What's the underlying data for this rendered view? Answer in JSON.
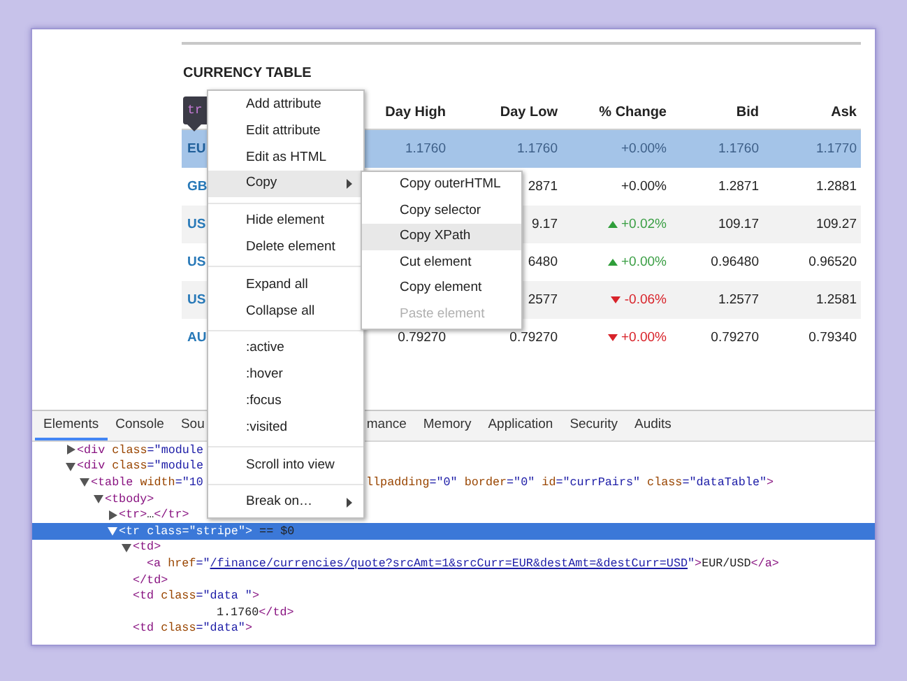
{
  "page": {
    "heading": "CURRENCY TABLE",
    "tooltip": "tr"
  },
  "table": {
    "columns": [
      "",
      "Day High",
      "Day Low",
      "% Change",
      "Bid",
      "Ask"
    ],
    "rows": [
      {
        "pair": "EU",
        "day_high": "1.1760",
        "day_low": "1.1760",
        "change": "+0.00%",
        "trend_up": false,
        "trend_down": false,
        "bid": "1.1760",
        "ask": "1.1770",
        "selected": true
      },
      {
        "pair": "GB",
        "day_low": "2871",
        "change": "+0.00%",
        "trend_up": false,
        "trend_down": false,
        "bid": "1.2871",
        "ask": "1.2881",
        "selected": false
      },
      {
        "pair": "US",
        "day_low": "9.17",
        "change": "+0.02%",
        "trend_up": true,
        "trend_down": false,
        "bid": "109.17",
        "ask": "109.27",
        "selected": false
      },
      {
        "pair": "US",
        "day_low": "6480",
        "change": "+0.00%",
        "trend_up": true,
        "trend_down": false,
        "bid": "0.96480",
        "ask": "0.96520",
        "selected": false
      },
      {
        "pair": "US",
        "day_low": "2577",
        "change": "-0.06%",
        "trend_up": false,
        "trend_down": true,
        "bid": "1.2577",
        "ask": "1.2581",
        "selected": false
      },
      {
        "pair": "AU",
        "day_high": "0.79270",
        "day_low": "0.79270",
        "change": "+0.00%",
        "trend_up": false,
        "trend_down": true,
        "bid": "0.79270",
        "ask": "0.79340",
        "selected": false
      }
    ]
  },
  "devtools": {
    "tabs": [
      {
        "label": "Elements",
        "selected": true
      },
      {
        "label": "Console",
        "selected": false
      },
      {
        "label": "Sou",
        "selected": false
      },
      {
        "label": "mance",
        "selected": false
      },
      {
        "label": "Memory",
        "selected": false
      },
      {
        "label": "Application",
        "selected": false
      },
      {
        "label": "Security",
        "selected": false
      },
      {
        "label": "Audits",
        "selected": false
      }
    ],
    "tree": [
      {
        "expanded": false,
        "selected": false,
        "parts": [
          {
            "kind": "tag",
            "text": "<div "
          },
          {
            "kind": "attr",
            "text": "class"
          },
          {
            "kind": "val",
            "text": "=\"module"
          }
        ]
      },
      {
        "expanded": true,
        "selected": false,
        "parts": [
          {
            "kind": "tag",
            "text": "<div "
          },
          {
            "kind": "attr",
            "text": "class"
          },
          {
            "kind": "val",
            "text": "=\"module"
          }
        ],
        "children": [
          {
            "expanded": true,
            "selected": false,
            "parts": [
              {
                "kind": "tag",
                "text": "<table "
              },
              {
                "kind": "attr",
                "text": "width"
              },
              {
                "kind": "val",
                "text": "=\"10"
              }
            ],
            "continuation": [
              {
                "kind": "attr",
                "text": "llpadding"
              },
              {
                "kind": "val",
                "text": "=\"0\""
              },
              {
                "kind": "attr",
                "text": " border"
              },
              {
                "kind": "val",
                "text": "=\"0\""
              },
              {
                "kind": "attr",
                "text": " id"
              },
              {
                "kind": "val",
                "text": "=\"currPairs\""
              },
              {
                "kind": "attr",
                "text": " class"
              },
              {
                "kind": "val",
                "text": "=\"dataTable\""
              },
              {
                "kind": "tag",
                "text": ">"
              }
            ],
            "children": [
              {
                "expanded": true,
                "selected": false,
                "parts": [
                  {
                    "kind": "tag",
                    "text": "<tbody>"
                  }
                ],
                "children": [
                  {
                    "expanded": false,
                    "selected": false,
                    "parts": [
                      {
                        "kind": "tag",
                        "text": "<tr>"
                      },
                      {
                        "kind": "text",
                        "text": "…"
                      },
                      {
                        "kind": "tag",
                        "text": "</tr>"
                      }
                    ]
                  },
                  {
                    "expanded": true,
                    "selected": true,
                    "parts": [
                      {
                        "kind": "tag",
                        "text": "<tr "
                      },
                      {
                        "kind": "attr",
                        "text": "class"
                      },
                      {
                        "kind": "val",
                        "text": "=\"stripe\""
                      },
                      {
                        "kind": "tag",
                        "text": ">"
                      },
                      {
                        "kind": "text",
                        "text": " == $0"
                      }
                    ],
                    "children": [
                      {
                        "expanded": true,
                        "selected": false,
                        "parts": [
                          {
                            "kind": "tag",
                            "text": "<td>"
                          }
                        ],
                        "children": [
                          {
                            "selected": false,
                            "parts": [
                              {
                                "kind": "tag",
                                "text": "<a "
                              },
                              {
                                "kind": "attr",
                                "text": "href"
                              },
                              {
                                "kind": "val",
                                "text": "=\""
                              },
                              {
                                "kind": "link",
                                "text": "/finance/currencies/quote?srcAmt=1&srcCurr=EUR&destAmt=&destCurr=USD"
                              },
                              {
                                "kind": "val",
                                "text": "\""
                              },
                              {
                                "kind": "tag",
                                "text": ">"
                              },
                              {
                                "kind": "text",
                                "text": "EUR/USD"
                              },
                              {
                                "kind": "tag",
                                "text": "</a>"
                              }
                            ]
                          }
                        ]
                      },
                      {
                        "selected": false,
                        "parts": [
                          {
                            "kind": "tag",
                            "text": "</td>"
                          }
                        ]
                      },
                      {
                        "selected": false,
                        "parts": [
                          {
                            "kind": "tag",
                            "text": "<td "
                          },
                          {
                            "kind": "attr",
                            "text": "class"
                          },
                          {
                            "kind": "val",
                            "text": "=\"data \""
                          },
                          {
                            "kind": "tag",
                            "text": ">"
                          }
                        ],
                        "children": [
                          {
                            "selected": false,
                            "parts": [
                              {
                                "kind": "text",
                                "text": "1.1760"
                              },
                              {
                                "kind": "tag",
                                "text": "</td>"
                              }
                            ]
                          }
                        ]
                      },
                      {
                        "selected": false,
                        "parts": [
                          {
                            "kind": "tag",
                            "text": "<td "
                          },
                          {
                            "kind": "attr",
                            "text": "class"
                          },
                          {
                            "kind": "val",
                            "text": "=\"data\""
                          },
                          {
                            "kind": "tag",
                            "text": ">"
                          }
                        ]
                      }
                    ]
                  }
                ]
              }
            ]
          }
        ]
      }
    ]
  },
  "context_menu": {
    "items": [
      {
        "kind": "item",
        "label": "Add attribute",
        "selected": false
      },
      {
        "kind": "item",
        "label": "Edit attribute",
        "selected": false
      },
      {
        "kind": "item",
        "label": "Edit as HTML",
        "selected": false
      },
      {
        "kind": "item",
        "label": "Copy",
        "selected": true,
        "submenu": true
      },
      {
        "kind": "separator"
      },
      {
        "kind": "item",
        "label": "Hide element",
        "selected": false
      },
      {
        "kind": "item",
        "label": "Delete element",
        "selected": false
      },
      {
        "kind": "separator"
      },
      {
        "kind": "item",
        "label": "Expand all",
        "selected": false
      },
      {
        "kind": "item",
        "label": "Collapse all",
        "selected": false
      },
      {
        "kind": "separator"
      },
      {
        "kind": "item",
        "label": ":active",
        "selected": false
      },
      {
        "kind": "item",
        "label": ":hover",
        "selected": false
      },
      {
        "kind": "item",
        "label": ":focus",
        "selected": false
      },
      {
        "kind": "item",
        "label": ":visited",
        "selected": false
      },
      {
        "kind": "separator"
      },
      {
        "kind": "item",
        "label": "Scroll into view",
        "selected": false
      },
      {
        "kind": "separator"
      },
      {
        "kind": "item",
        "label": "Break on…",
        "selected": false,
        "submenu": true
      }
    ]
  },
  "submenu": {
    "items": [
      {
        "label": "Copy outerHTML",
        "selected": false,
        "disabled": false
      },
      {
        "label": "Copy selector",
        "selected": false,
        "disabled": false
      },
      {
        "label": "Copy XPath",
        "selected": true,
        "disabled": false
      },
      {
        "label": "Cut element",
        "selected": false,
        "disabled": false
      },
      {
        "label": "Copy element",
        "selected": false,
        "disabled": false
      },
      {
        "label": "Paste element",
        "selected": false,
        "disabled": true
      }
    ]
  }
}
